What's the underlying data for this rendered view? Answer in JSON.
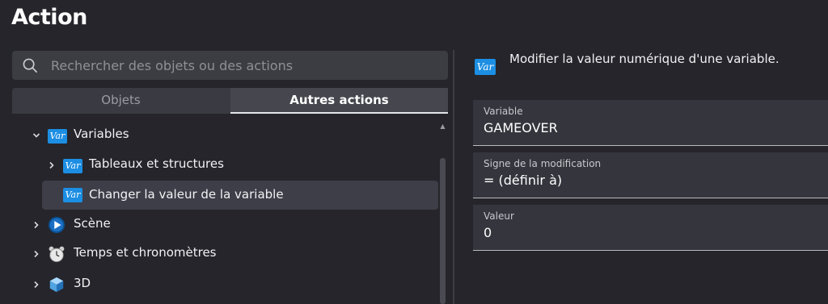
{
  "dialog": {
    "title": "Action"
  },
  "search": {
    "placeholder": "Rechercher des objets ou des actions",
    "value": ""
  },
  "tabs": [
    {
      "label": "Objets",
      "active": false
    },
    {
      "label": "Autres actions",
      "active": true
    }
  ],
  "tree": {
    "variables": {
      "label": "Variables",
      "icon": "var-icon",
      "icon_text": "Var"
    },
    "tableaux": {
      "label": "Tableaux et structures",
      "icon": "var-icon",
      "icon_text": "Var"
    },
    "changer": {
      "label": "Changer la valeur de la variable",
      "icon": "var-icon",
      "icon_text": "Var",
      "selected": true
    },
    "scene": {
      "label": "Scène",
      "icon": "play-icon"
    },
    "temps": {
      "label": "Temps et chronomètres",
      "icon": "alarm-clock-icon"
    },
    "d3": {
      "label": "3D",
      "icon": "cube-icon"
    }
  },
  "details": {
    "icon_text": "Var",
    "description": "Modifier la valeur numérique d'une variable.",
    "fields": [
      {
        "label": "Variable",
        "value": "GAMEOVER"
      },
      {
        "label": "Signe de la modification",
        "value": "= (définir à)"
      },
      {
        "label": "Valeur",
        "value": "0"
      }
    ]
  },
  "colors": {
    "background": "#25252b",
    "var_icon": "#1c8ee3",
    "selected_row": "#3d3e48",
    "field_background": "#35353d"
  }
}
